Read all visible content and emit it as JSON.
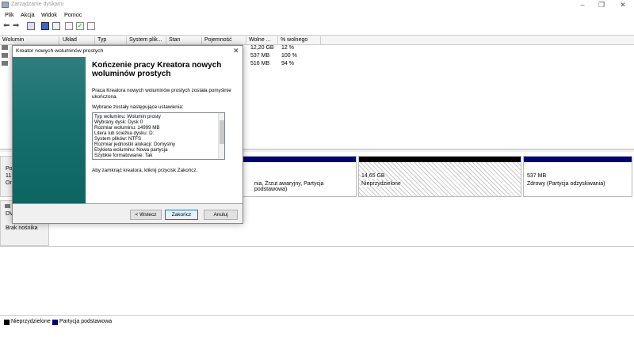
{
  "window": {
    "title": "Zarządzanie dyskami"
  },
  "menu": [
    "Plik",
    "Akcja",
    "Widok",
    "Pomoc"
  ],
  "table": {
    "headers": [
      "Wolumin",
      "Układ",
      "Typ",
      "System plik...",
      "Stan",
      "Pojemność",
      "Wolne ...",
      "% wolnego"
    ],
    "rows": [
      {
        "free": "12,20 GB",
        "pct": "12 %"
      },
      {
        "free": "537 MB",
        "pct": "100 %"
      },
      {
        "free": "516 MB",
        "pct": "94 %"
      }
    ]
  },
  "disks": {
    "disk0_label_lines": [
      "Po",
      "11",
      "Or"
    ],
    "seg_primary_text": "nia, Zrzut awaryjny, Partycja podstawowa)",
    "seg_unallocated": {
      "size": "14,65 GB",
      "label": "Nieprzydzielone"
    },
    "seg_recovery": {
      "size": "537 MB",
      "label": "Zdrowy (Partycja odzyskiwania)"
    },
    "dvd_label": "DV",
    "dvd_status": "Brak nośnika"
  },
  "legend": [
    {
      "label": "Nieprzydzielone",
      "color": "#000000"
    },
    {
      "label": "Partycja podstawowa",
      "color": "#00007f"
    }
  ],
  "dialog": {
    "title": "Kreator nowych woluminów prostych",
    "heading": "Kończenie pracy Kreatora nowych woluminów prostych",
    "desc": "Praca Kreatora nowych woluminów prostych została pomyślnie ukończona.",
    "settings_label": "Wybrane zostały następujące ustawienia:",
    "settings": [
      "Typ woluminu: Wolumin prosty",
      "Wybrany dysk: Dysk 0",
      "Rozmiar woluminu: 14999 MB",
      "Litera lub ścieżka dysku: D:",
      "System plików: NTFS",
      "Rozmiar jednostki alokacji: Domyślny",
      "Etykieta woluminu: Nowa partycja",
      "Szybkie formatowanie: Tak"
    ],
    "close_hint": "Aby zamknąć kreatora, kliknij przycisk Zakończ.",
    "buttons": {
      "back": "< Wstecz",
      "finish": "Zakończ",
      "cancel": "Anuluj"
    }
  },
  "colors": {
    "primary_partition": "#00007f",
    "unallocated": "#000000",
    "banner": "#17706d"
  }
}
